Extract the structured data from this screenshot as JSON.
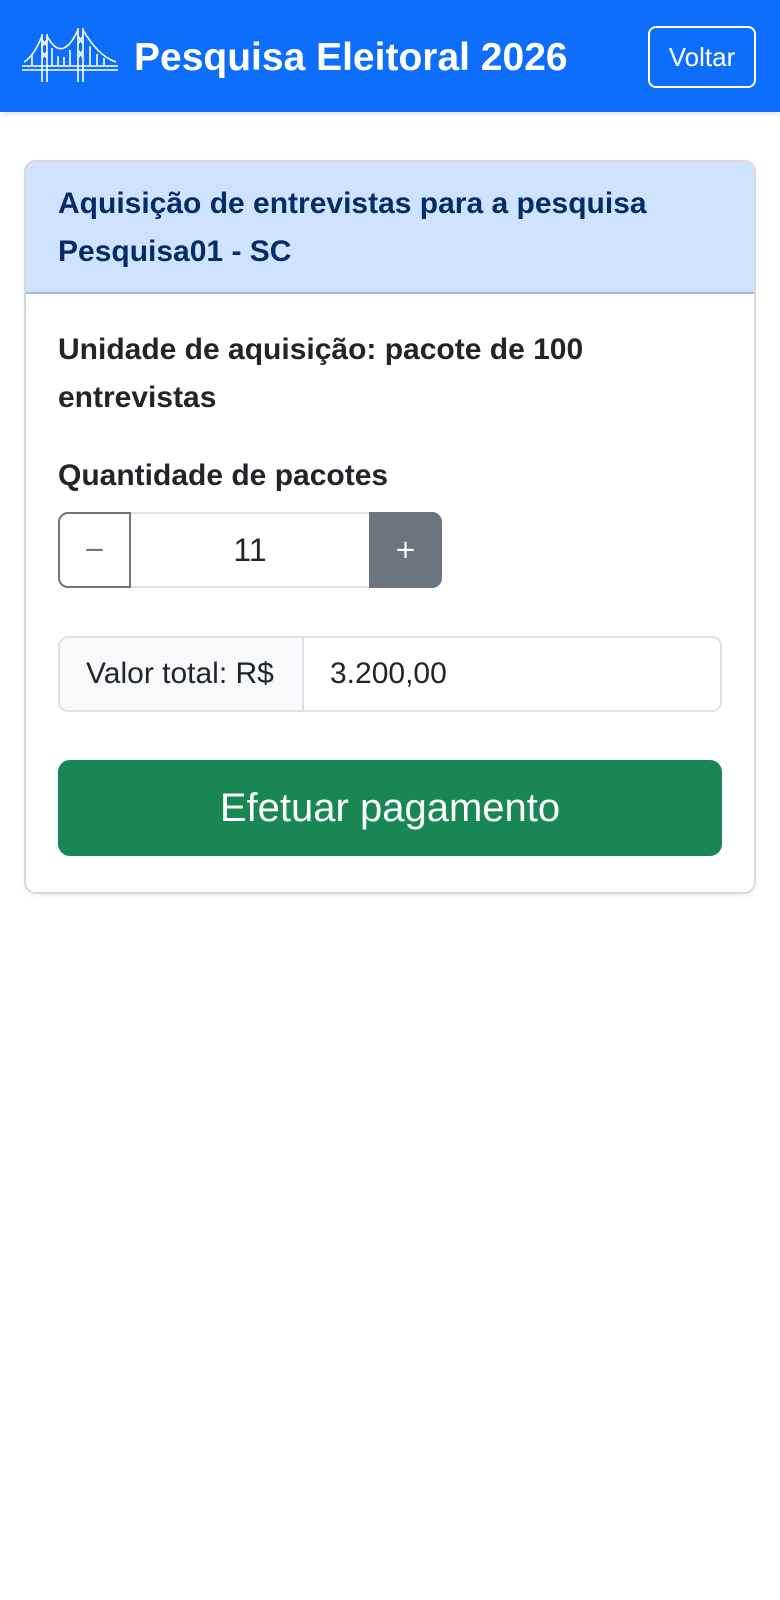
{
  "header": {
    "title": "Pesquisa Eleitoral 2026",
    "back_label": "Voltar",
    "logo_icon": "bridge-icon",
    "background_color": "#0d6efd"
  },
  "card": {
    "header_line1": "Aquisição de entrevistas para a pesquisa",
    "header_line2": "Pesquisa01 - SC",
    "unit_text": "Unidade de aquisição: pacote de 100 entrevistas",
    "quantity_label": "Quantidade de pacotes",
    "quantity_value": "11",
    "minus_label": "−",
    "plus_label": "+",
    "total_label": "Valor total: R$",
    "total_value": "3.200,00",
    "pay_label": "Efetuar pagamento",
    "pay_color": "#198754"
  }
}
